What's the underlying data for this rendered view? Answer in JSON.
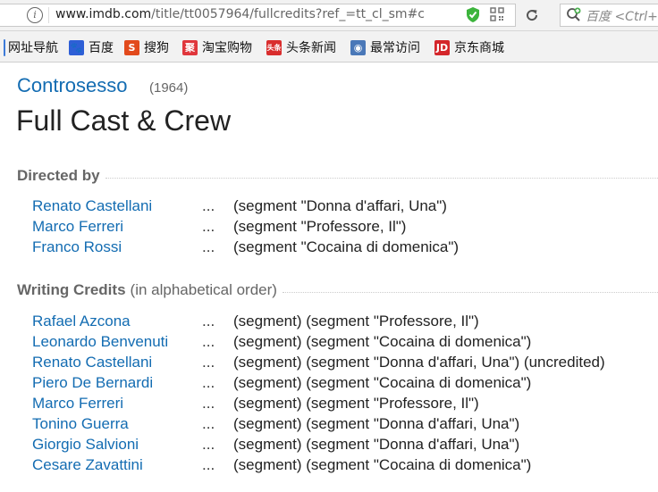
{
  "browser": {
    "url_domain": "www.imdb.com",
    "url_path": "/title/tt0057964/fullcredits?ref_=tt_cl_sm#c",
    "search_placeholder": "百度 <Ctrl+K>"
  },
  "bookmarks": [
    {
      "label": "网址导航",
      "icon": "globe-icon",
      "color": "#3d7bd8"
    },
    {
      "label": "百度",
      "icon": "baidu-paw-icon",
      "color": "#2e5fd6"
    },
    {
      "label": "搜狗",
      "icon": "sogou-icon",
      "color": "#e24a1c"
    },
    {
      "label": "淘宝购物",
      "icon": "taobao-icon",
      "color": "#e0363c"
    },
    {
      "label": "头条新闻",
      "icon": "toutiao-icon",
      "color": "#d92d2d"
    },
    {
      "label": "最常访问",
      "icon": "most-visited-icon",
      "color": "#4a78b8"
    },
    {
      "label": "京东商城",
      "icon": "jd-icon",
      "color": "#d4262b"
    }
  ],
  "page": {
    "movie_title": "Controsesso",
    "movie_year": "(1964)",
    "title": "Full Cast & Crew"
  },
  "sections": {
    "directed": {
      "heading": "Directed by",
      "rows": [
        {
          "name": "Renato Castellani",
          "dots": "...",
          "credit": "(segment \"Donna d'affari, Una\")"
        },
        {
          "name": "Marco Ferreri",
          "dots": "...",
          "credit": "(segment \"Professore, Il\")"
        },
        {
          "name": "Franco Rossi",
          "dots": "...",
          "credit": "(segment \"Cocaina di domenica\")"
        }
      ]
    },
    "writing": {
      "heading": "Writing Credits",
      "subheading": "(in alphabetical order)",
      "rows": [
        {
          "name": "Rafael Azcona",
          "dots": "...",
          "credit": "(segment) (segment \"Professore, Il\")"
        },
        {
          "name": "Leonardo Benvenuti",
          "dots": "...",
          "credit": "(segment) (segment \"Cocaina di domenica\")"
        },
        {
          "name": "Renato Castellani",
          "dots": "...",
          "credit": "(segment) (segment \"Donna d'affari, Una\") (uncredited)"
        },
        {
          "name": "Piero De Bernardi",
          "dots": "...",
          "credit": "(segment) (segment \"Cocaina di domenica\")"
        },
        {
          "name": "Marco Ferreri",
          "dots": "...",
          "credit": "(segment) (segment \"Professore, Il\")"
        },
        {
          "name": "Tonino Guerra",
          "dots": "...",
          "credit": "(segment) (segment \"Donna d'affari, Una\")"
        },
        {
          "name": "Giorgio Salvioni",
          "dots": "...",
          "credit": "(segment) (segment \"Donna d'affari, Una\")"
        },
        {
          "name": "Cesare Zavattini",
          "dots": "...",
          "credit": "(segment) (segment \"Cocaina di domenica\")"
        }
      ]
    }
  }
}
